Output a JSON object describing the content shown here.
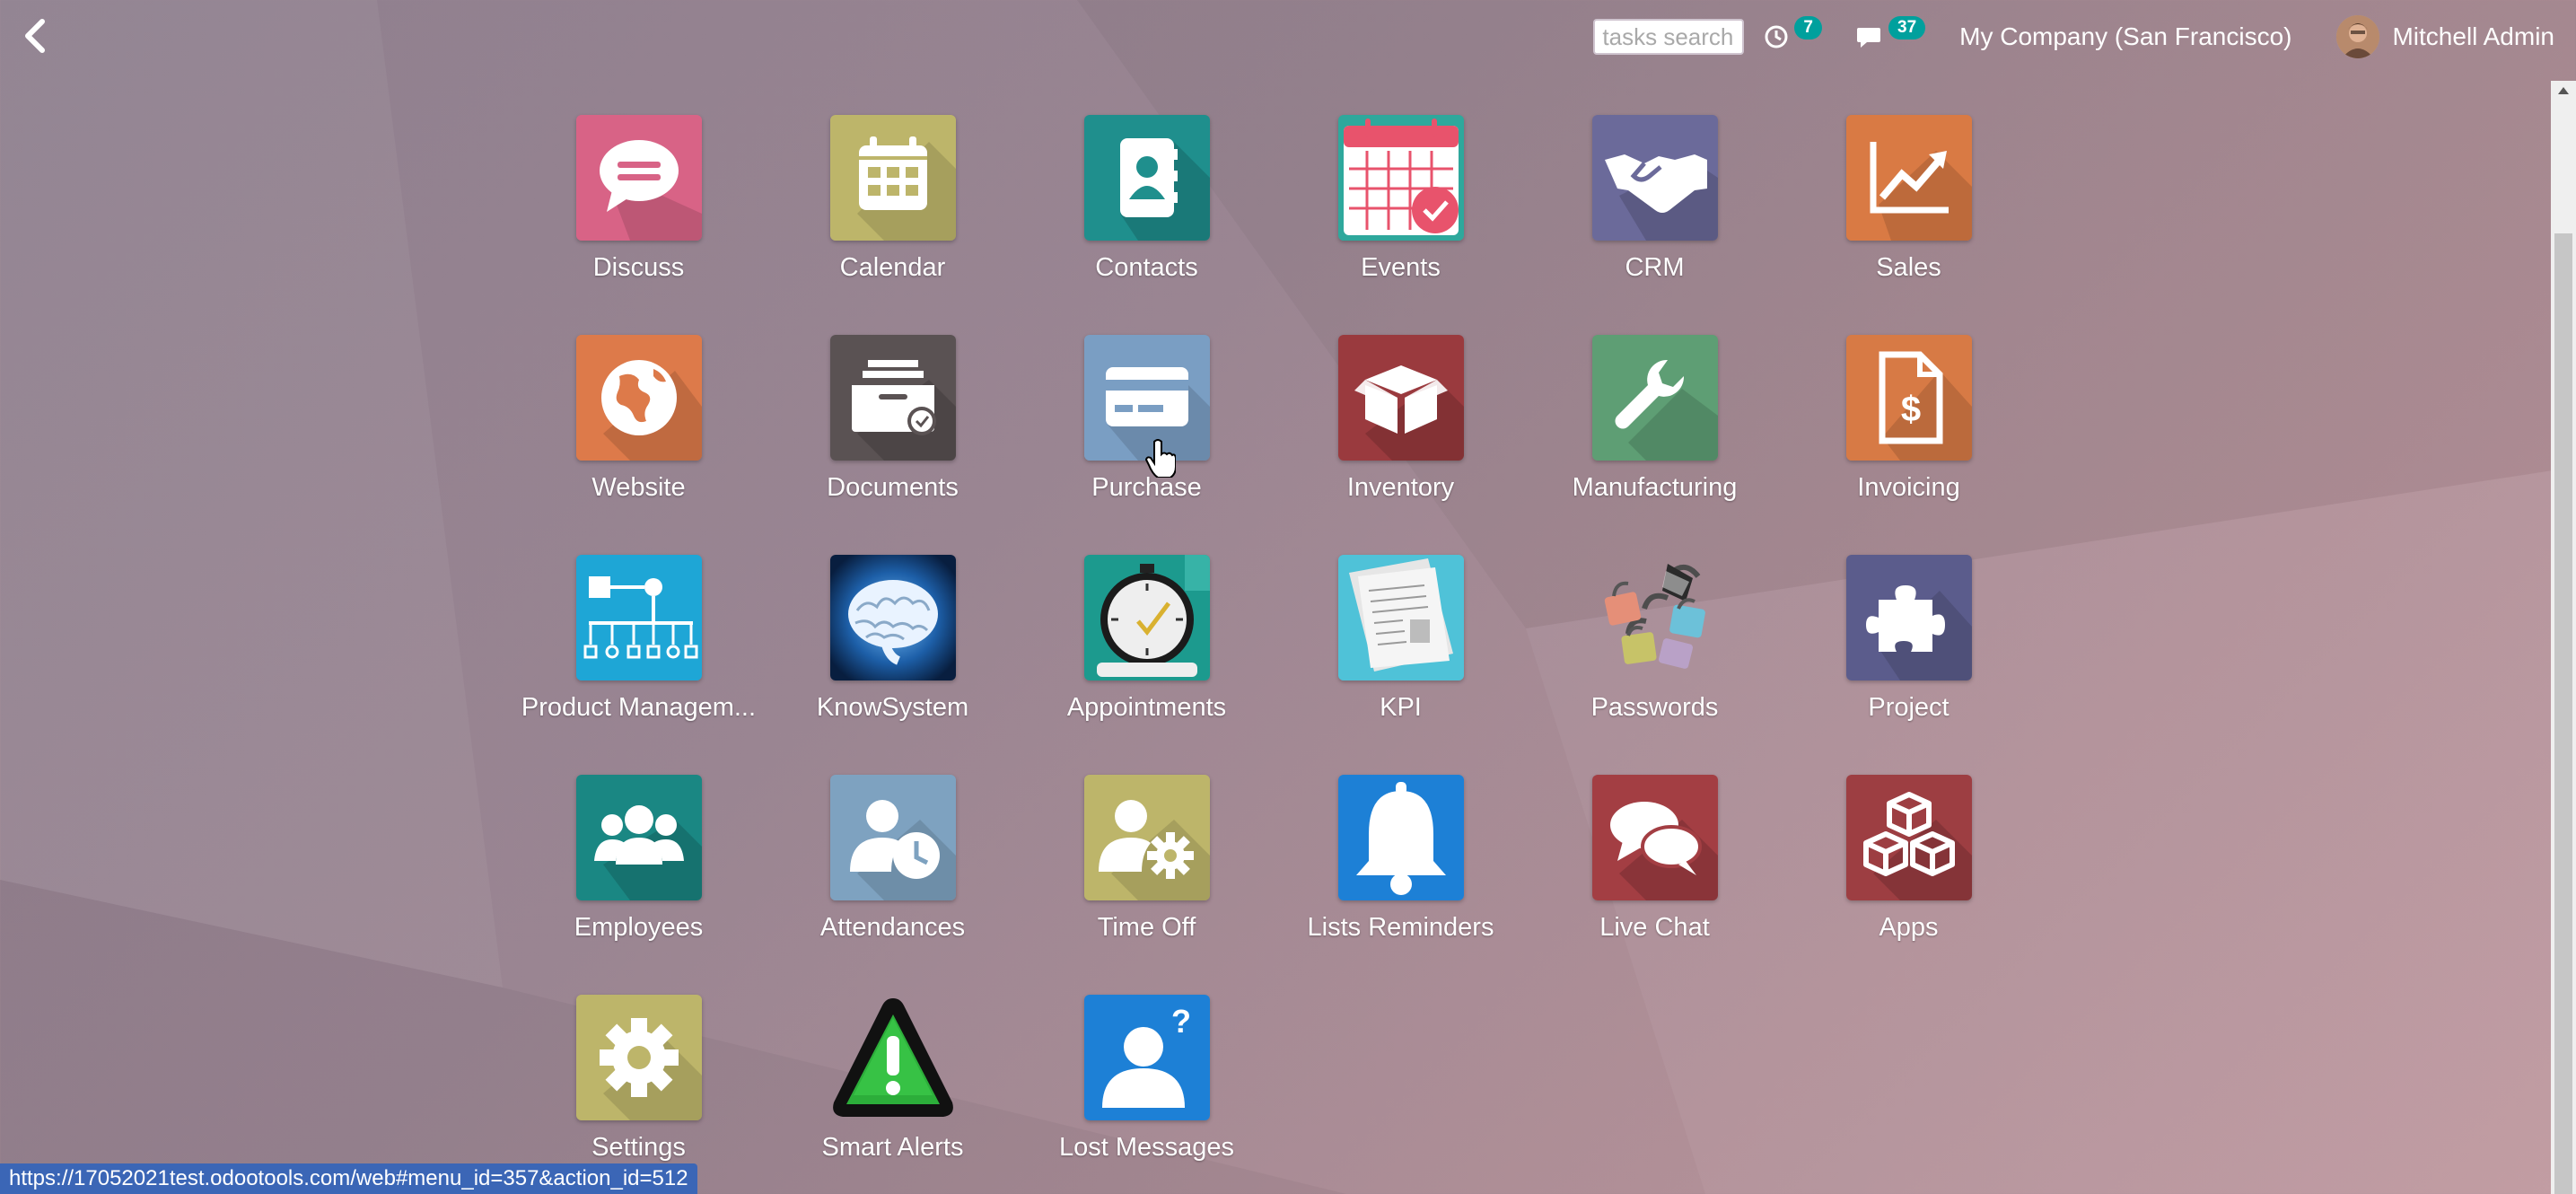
{
  "topbar": {
    "search_placeholder": "tasks search",
    "activity_count": "7",
    "messages_count": "37",
    "company": "My Company (San Francisco)",
    "user": "Mitchell Admin"
  },
  "apps": [
    {
      "label": "Discuss",
      "icon": "chat-bubble-icon"
    },
    {
      "label": "Calendar",
      "icon": "calendar-icon"
    },
    {
      "label": "Contacts",
      "icon": "address-book-icon"
    },
    {
      "label": "Events",
      "icon": "event-calendar-check-icon"
    },
    {
      "label": "CRM",
      "icon": "handshake-icon"
    },
    {
      "label": "Sales",
      "icon": "trend-chart-icon"
    },
    {
      "label": "Website",
      "icon": "globe-icon"
    },
    {
      "label": "Documents",
      "icon": "document-tray-icon"
    },
    {
      "label": "Purchase",
      "icon": "credit-card-icon"
    },
    {
      "label": "Inventory",
      "icon": "open-box-icon"
    },
    {
      "label": "Manufacturing",
      "icon": "wrench-icon"
    },
    {
      "label": "Invoicing",
      "icon": "invoice-dollar-icon"
    },
    {
      "label": "Product Managem...",
      "icon": "org-chart-icon"
    },
    {
      "label": "KnowSystem",
      "icon": "brain-icon"
    },
    {
      "label": "Appointments",
      "icon": "stopwatch-icon"
    },
    {
      "label": "KPI",
      "icon": "newspaper-icon"
    },
    {
      "label": "Passwords",
      "icon": "padlocks-icon"
    },
    {
      "label": "Project",
      "icon": "puzzle-icon"
    },
    {
      "label": "Employees",
      "icon": "people-icon"
    },
    {
      "label": "Attendances",
      "icon": "user-clock-icon"
    },
    {
      "label": "Time Off",
      "icon": "user-gear-icon"
    },
    {
      "label": "Lists Reminders",
      "icon": "bell-icon"
    },
    {
      "label": "Live Chat",
      "icon": "chat-bubbles-icon"
    },
    {
      "label": "Apps",
      "icon": "cubes-icon"
    },
    {
      "label": "Settings",
      "icon": "gear-icon"
    },
    {
      "label": "Smart Alerts",
      "icon": "warning-triangle-icon"
    },
    {
      "label": "Lost Messages",
      "icon": "user-question-icon"
    }
  ],
  "status_url": "https://17052021test.odootools.com/web#menu_id=357&action_id=512"
}
